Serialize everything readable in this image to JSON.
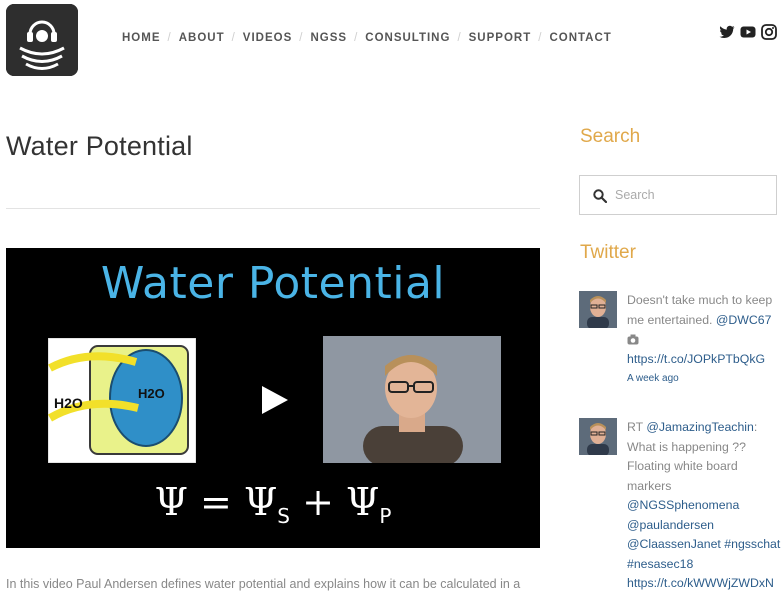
{
  "header": {
    "nav": [
      {
        "label": "HOME"
      },
      {
        "label": "ABOUT"
      },
      {
        "label": "VIDEOS"
      },
      {
        "label": "NGSS"
      },
      {
        "label": "CONSULTING"
      },
      {
        "label": "SUPPORT"
      },
      {
        "label": "CONTACT"
      }
    ],
    "social_icons": [
      "twitter-icon",
      "youtube-icon",
      "instagram-icon"
    ]
  },
  "main": {
    "title": "Water Potential",
    "video": {
      "heading": "Water Potential",
      "diagram_label_left": "H2O",
      "diagram_label_right": "H2O",
      "formula_psi": "Ψ",
      "formula_eq": " = ",
      "formula_plus": " + ",
      "formula_sub_s": "S",
      "formula_sub_p": "P"
    },
    "description": "In this video Paul Andersen defines water potential and explains how it can be calculated in a"
  },
  "sidebar": {
    "search_heading": "Search",
    "search_placeholder": "Search",
    "twitter_heading": "Twitter",
    "tweets": [
      {
        "line1": "Doesn't take much to keep",
        "line2_text": "me entertained. ",
        "line2_mention": "@DWC67",
        "link": "https://t.co/JOPkPTbQkG",
        "time": "A week ago"
      },
      {
        "line1_text": "RT ",
        "line1_mention": "@JamazingTeachin",
        "line1_end": ":",
        "line2": "What is happening ??",
        "line3": "Floating white board",
        "line4": "markers",
        "mention1": "@NGSSphenomena",
        "mention2": "@paulandersen",
        "mention3": "@ClaassenJanet",
        "tag1": " #ngsschat",
        "tag2": "#nesasec18",
        "link": "https://t.co/kWWWjZWDxN"
      }
    ]
  },
  "colors": {
    "accent": "#e0a84a",
    "link": "#2d5d8b",
    "video_title": "#4ab4e6"
  }
}
